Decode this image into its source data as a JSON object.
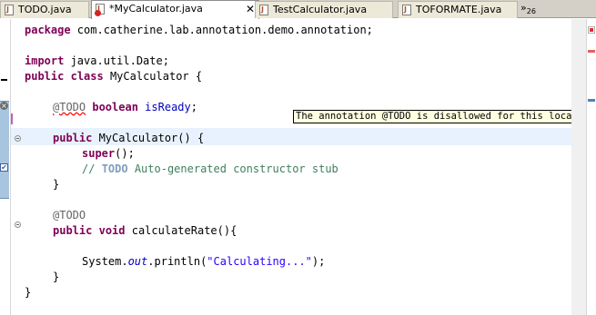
{
  "tabs": [
    {
      "label": "TODO.java"
    },
    {
      "label": "*MyCalculator.java",
      "close": "✕"
    },
    {
      "label": "TestCalculator.java"
    },
    {
      "label": "TOFORMATE.java"
    }
  ],
  "overflow": {
    "chevron": "»",
    "count": "26"
  },
  "tooltip": "The annotation @TODO is disallowed for this location",
  "code": {
    "l1_kw": "package",
    "l1_rest": " com.catherine.lab.annotation.demo.annotation;",
    "l2_kw": "import",
    "l2_rest": " java.util.Date;",
    "l3_kw1": "public",
    "l3_kw2": "class",
    "l3_rest": " MyCalculator {",
    "l4_ann": "@TODO",
    "l4_kw": "boolean",
    "l4_field": "isReady",
    "l4_end": ";",
    "l5_kw": "public",
    "l5_rest": " MyCalculator() {",
    "l6_kw": "super",
    "l6_rest": "();",
    "l7_cm1": "// ",
    "l7_todo": "TODO",
    "l7_cm2": " Auto-generated constructor stub",
    "l8": "}",
    "l9_ann": "@TODO",
    "l10_kw1": "public",
    "l10_kw2": "void",
    "l10_rest": " calculateRate(){",
    "l11_a": "System.",
    "l11_out": "out",
    "l11_b": ".println(",
    "l11_str": "\"Calculating...\"",
    "l11_c": ");",
    "l12": "}",
    "l13": "}"
  }
}
